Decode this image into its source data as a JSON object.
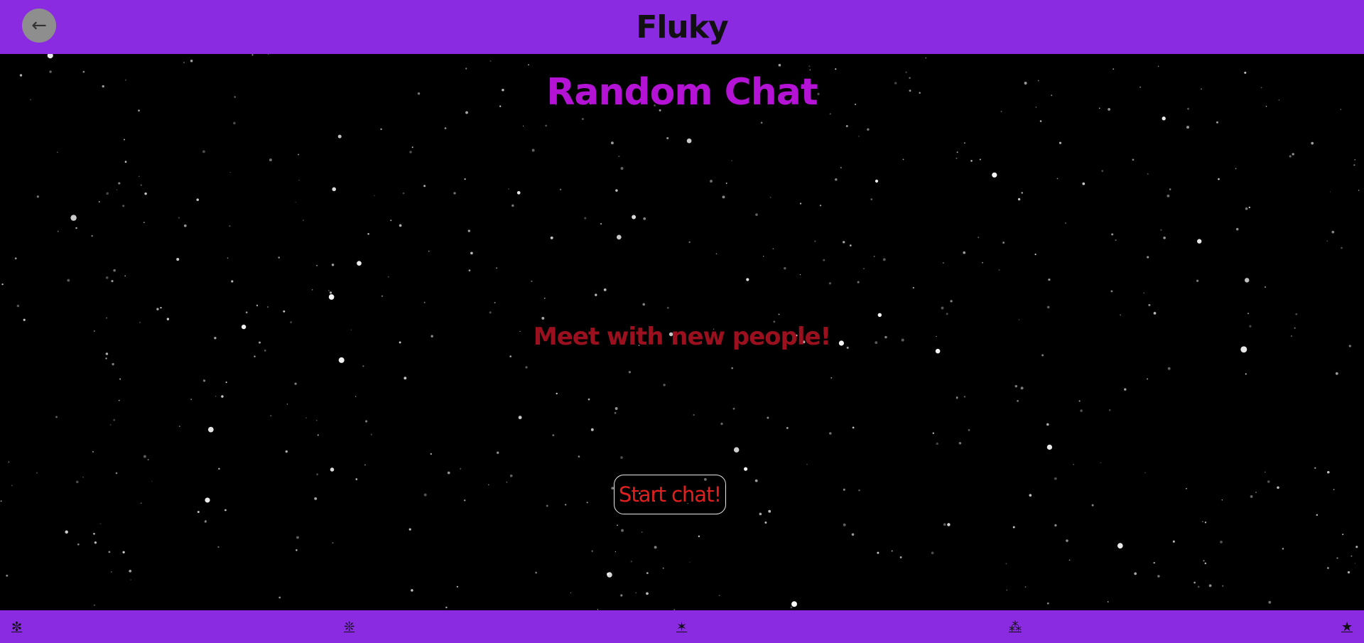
{
  "header": {
    "back_label": "←",
    "title": "Fluky"
  },
  "main": {
    "title": "Random Chat",
    "subtitle": "Meet with new people!",
    "start_button_label": "Start chat!"
  },
  "footer": {
    "icons": [
      {
        "glyph": "✼",
        "name": "asterisk-star-icon"
      },
      {
        "glyph": "❊",
        "name": "flower-star-icon"
      },
      {
        "glyph": "✶",
        "name": "six-point-star-icon"
      },
      {
        "glyph": "⁂",
        "name": "sparkle-star-icon"
      },
      {
        "glyph": "★",
        "name": "solid-star-icon"
      }
    ]
  },
  "colors": {
    "header_bg": "#8a2be2",
    "title": "#b413d6",
    "subtitle": "#9a101e",
    "button_text": "#e0201e",
    "background": "#000000"
  }
}
